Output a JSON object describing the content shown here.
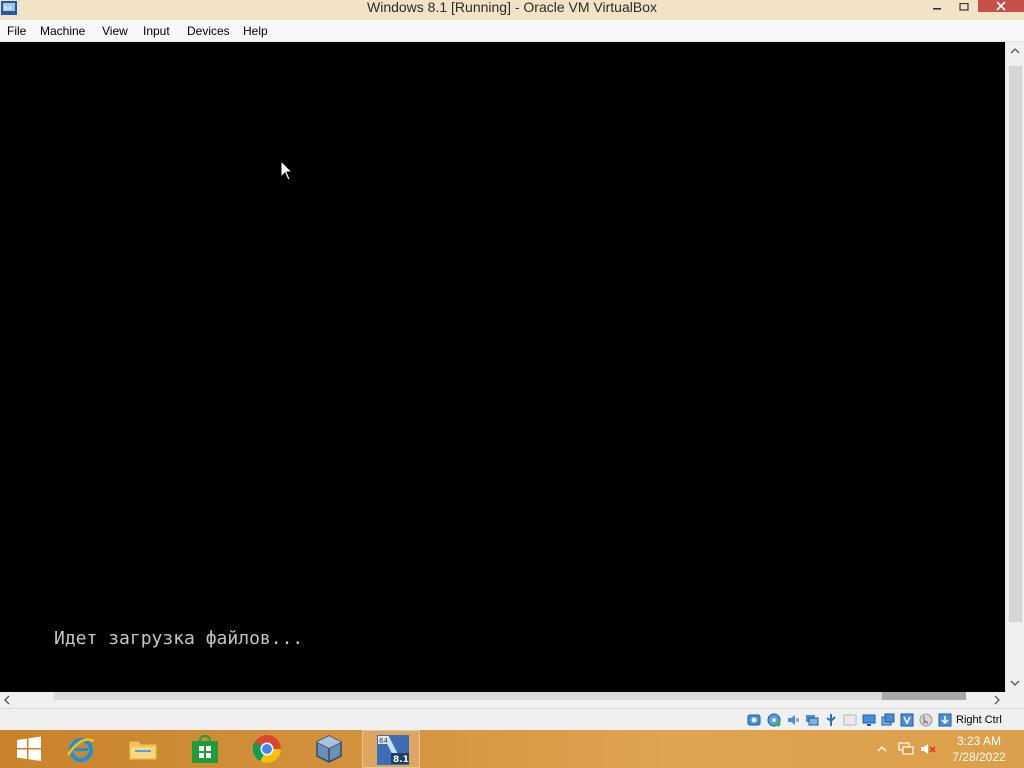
{
  "window": {
    "title": "Windows 8.1 [Running] - Oracle VM VirtualBox"
  },
  "menu": {
    "items": [
      "File",
      "Machine",
      "View",
      "Input",
      "Devices",
      "Help"
    ]
  },
  "vm": {
    "console_text": "Идет загрузка файлов..."
  },
  "statusbar": {
    "icons": [
      "hard-disk-icon",
      "optical-drive-icon",
      "audio-icon",
      "network-icon",
      "usb-icon",
      "shared-folders-icon",
      "display-icon",
      "video-capture-icon",
      "virtualization-icon",
      "mouse-integration-icon",
      "keyboard-capture-icon"
    ],
    "host_key": "Right Ctrl"
  },
  "taskbar": {
    "apps": [
      "start-button",
      "internet-explorer",
      "file-explorer",
      "windows-store",
      "google-chrome",
      "virtualbox-manager",
      "windows-8.1-vm"
    ],
    "vm_badge_bits": "64",
    "vm_badge_version": "8.1",
    "clock_time": "3:23 AM",
    "clock_date": "7/28/2022"
  },
  "colors": {
    "titlebar_bg": "#f3e3c6",
    "close_button": "#c7504a",
    "taskbar_accent": "#d69440",
    "console_text": "#c4c4c4"
  }
}
